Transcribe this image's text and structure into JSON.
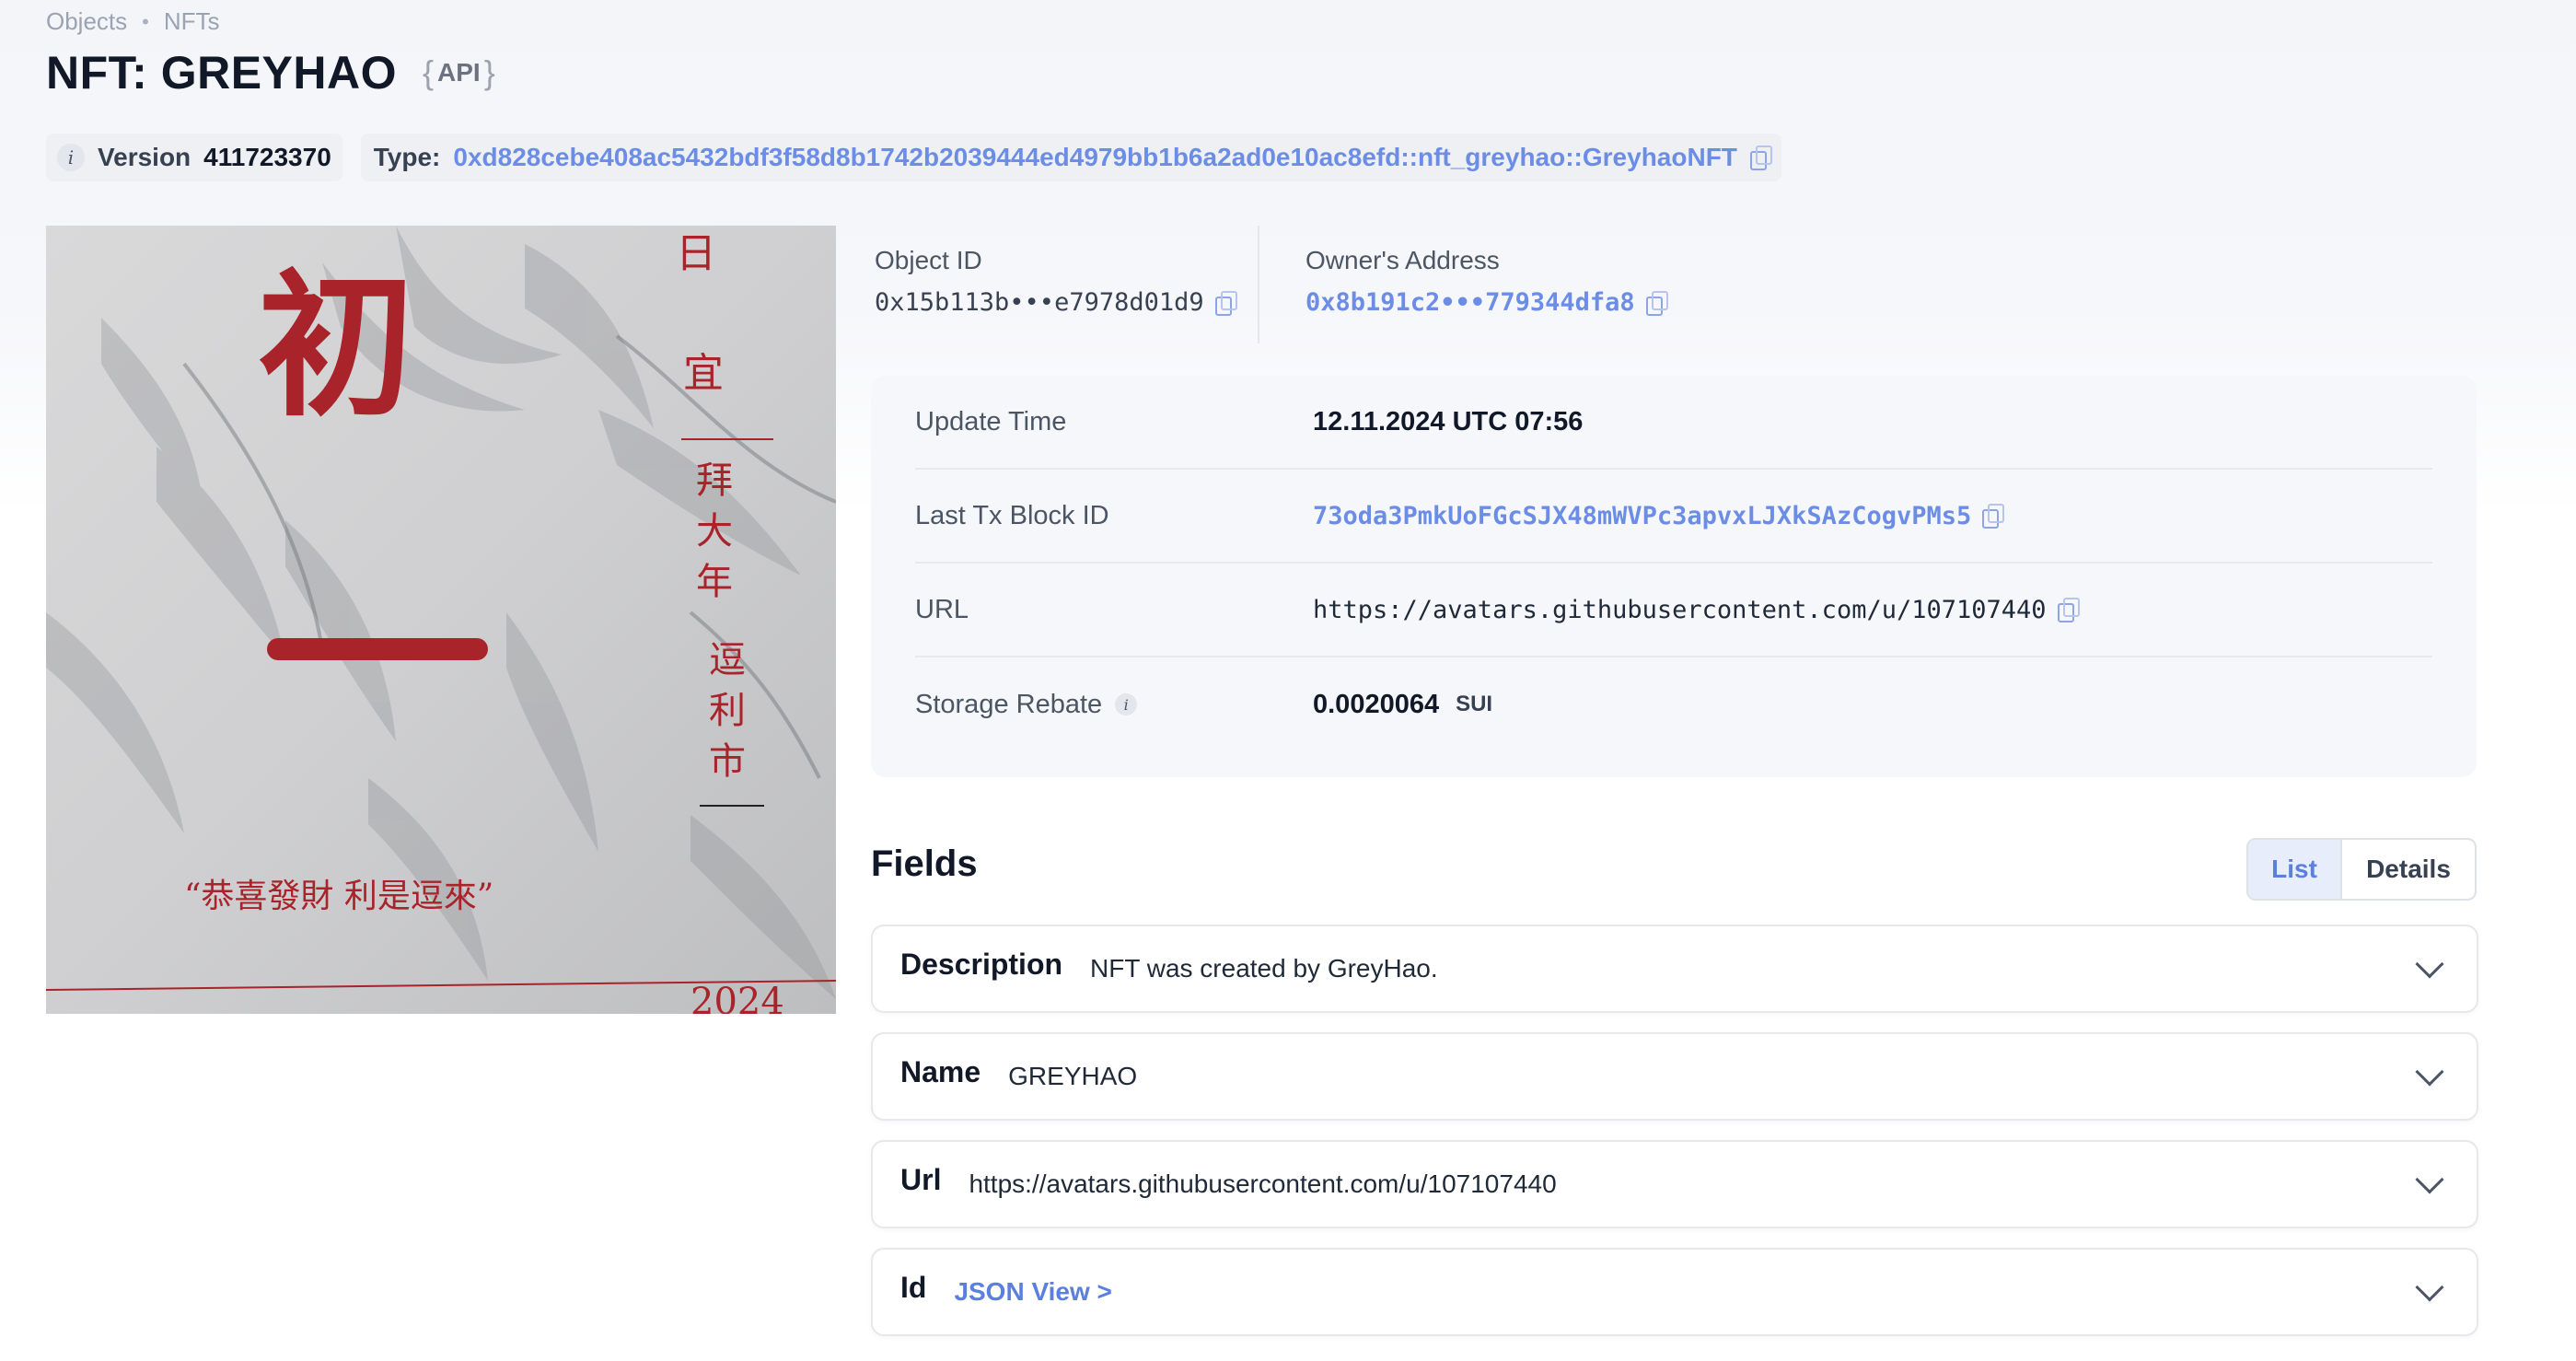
{
  "breadcrumb": {
    "first": "Objects",
    "sep": "•",
    "second": "NFTs"
  },
  "page": {
    "title": "NFT: GREYHAO",
    "api_open": "{",
    "api_label": "API",
    "api_close": "}"
  },
  "chips": {
    "info_glyph": "i",
    "version_label": "Version",
    "version_value": "411723370",
    "type_label": "Type:",
    "type_value": "0xd828cebe408ac5432bdf3f58d8b1742b2039444ed4979bb1b6a2ad0e10ac8efd::nft_greyhao::GreyhaoNFT"
  },
  "ids": {
    "object_label": "Object ID",
    "object_value": "0x15b113b•••e7978d01d9",
    "owner_label": "Owner's Address",
    "owner_value": "0x8b191c2•••779344dfa8"
  },
  "details": {
    "update_time_label": "Update Time",
    "update_time_value": "12.11.2024 UTC 07:56",
    "last_tx_label": "Last Tx Block ID",
    "last_tx_value": "73oda3PmkUoFGcSJX48mWVPc3apvxLJXkSAzCogvPMs5",
    "url_label": "URL",
    "url_value": "https://avatars.githubusercontent.com/u/107107440",
    "storage_label": "Storage Rebate",
    "storage_value": "0.0020064",
    "storage_unit": "SUI"
  },
  "fields": {
    "title": "Fields",
    "view_list": "List",
    "view_details": "Details",
    "items": [
      {
        "key": "Description",
        "value": "NFT was created by GreyHao."
      },
      {
        "key": "Name",
        "value": "GREYHAO"
      },
      {
        "key": "Url",
        "value": "https://avatars.githubusercontent.com/u/107107440"
      },
      {
        "key": "Id",
        "value": "JSON View >"
      }
    ]
  },
  "nft_image": {
    "glyphs": [
      "初",
      "一",
      "日",
      "宜",
      "拜",
      "大",
      "年",
      "逗",
      "利",
      "市"
    ],
    "caption": "“恭喜發財  利是逗來”",
    "bottom_text": "2024"
  },
  "colors": {
    "link": "#6b8de6",
    "accent": "#5b7fdf",
    "panel_bg": "#f6f7fa"
  }
}
